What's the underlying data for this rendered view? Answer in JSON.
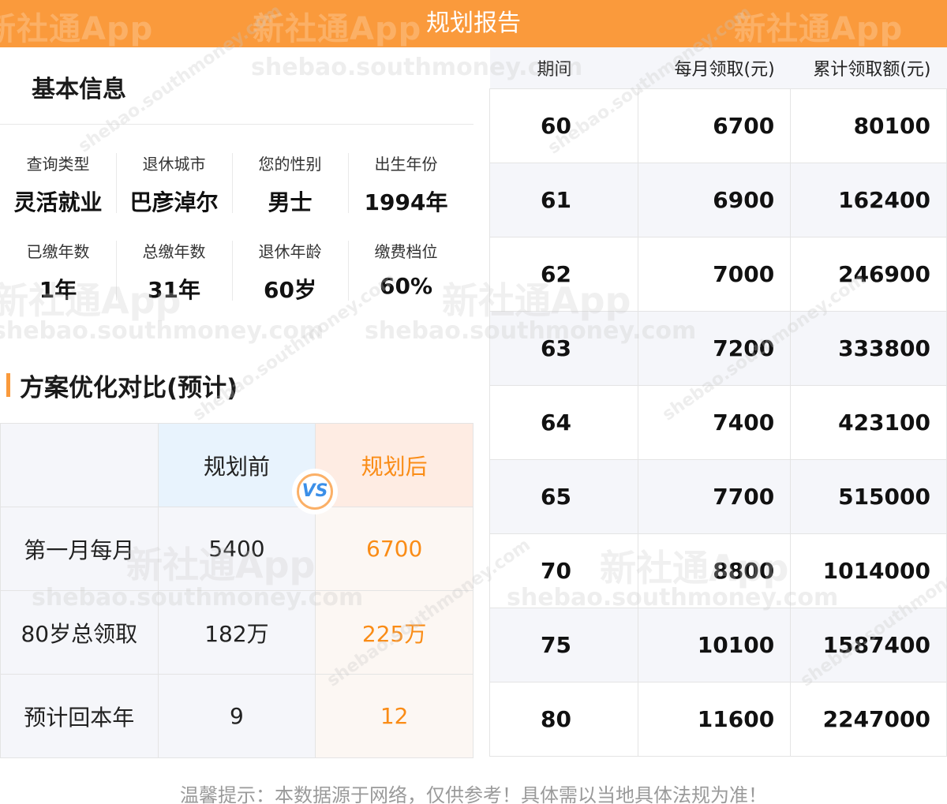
{
  "header": {
    "title": "规划报告"
  },
  "watermark": {
    "brand": "新社通App",
    "logo": "SL",
    "domain": "shebao.southmoney.com"
  },
  "basic_info": {
    "title": "基本信息",
    "rows": [
      [
        {
          "label": "查询类型",
          "value": "灵活就业"
        },
        {
          "label": "退休城市",
          "value": "巴彦淖尔"
        },
        {
          "label": "您的性别",
          "value": "男士"
        },
        {
          "label": "出生年份",
          "value": "1994年"
        }
      ],
      [
        {
          "label": "已缴年数",
          "value": "1年"
        },
        {
          "label": "总缴年数",
          "value": "31年"
        },
        {
          "label": "退休年龄",
          "value": "60岁"
        },
        {
          "label": "缴费档位",
          "value": "60%"
        }
      ]
    ]
  },
  "comparison": {
    "title": "方案优化对比(预计)",
    "col_before": "规划前",
    "col_after": "规划后",
    "vs": "VS",
    "rows": [
      {
        "label": "第一月每月",
        "before": "5400",
        "after": "6700"
      },
      {
        "label": "80岁总领取",
        "before": "182万",
        "after": "225万"
      },
      {
        "label": "预计回本年",
        "before": "9",
        "after": "12"
      }
    ]
  },
  "pension_table": {
    "headers": [
      "期间",
      "每月领取(元)",
      "累计领取额(元)"
    ],
    "rows": [
      [
        "60",
        "6700",
        "80100"
      ],
      [
        "61",
        "6900",
        "162400"
      ],
      [
        "62",
        "7000",
        "246900"
      ],
      [
        "63",
        "7200",
        "333800"
      ],
      [
        "64",
        "7400",
        "423100"
      ],
      [
        "65",
        "7700",
        "515000"
      ],
      [
        "70",
        "8800",
        "1014000"
      ],
      [
        "75",
        "10100",
        "1587400"
      ],
      [
        "80",
        "11600",
        "2247000"
      ]
    ]
  },
  "footer": {
    "text": "温馨提示：本数据源于网络，仅供参考！具体需以当地具体法规为准！"
  },
  "colors": {
    "accent": "#fa9a3c",
    "after_text": "#fa8c16",
    "before_header_bg": "#e8f3fd",
    "after_header_bg": "#feece3"
  }
}
